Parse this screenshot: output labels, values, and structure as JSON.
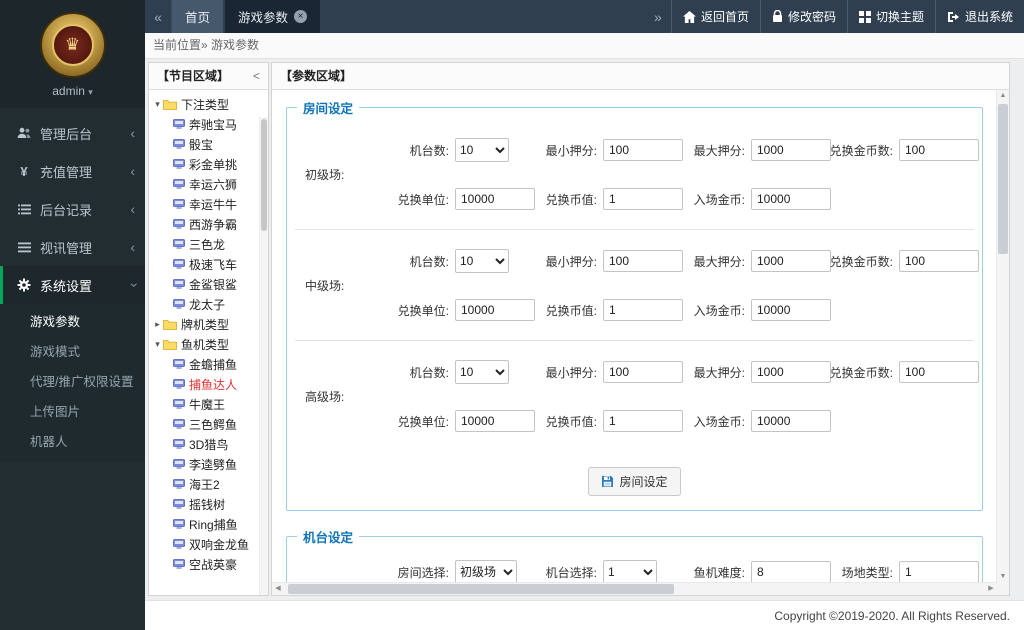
{
  "colors": {
    "accent_green": "#00a65a",
    "legend_blue": "#0d74b8",
    "selected_red": "#e53030",
    "sidebar_bg": "#222d32"
  },
  "sidebar": {
    "username": "admin",
    "menu": [
      {
        "label": "管理后台",
        "icon": "users-icon"
      },
      {
        "label": "充值管理",
        "icon": "yen-icon"
      },
      {
        "label": "后台记录",
        "icon": "list-icon"
      },
      {
        "label": "视讯管理",
        "icon": "rows-icon"
      },
      {
        "label": "系统设置",
        "icon": "gears-icon",
        "expanded": true,
        "active": true
      }
    ],
    "submenu": [
      {
        "label": "游戏参数",
        "active": true
      },
      {
        "label": "游戏模式"
      },
      {
        "label": "代理/推广权限设置"
      },
      {
        "label": "上传图片"
      },
      {
        "label": "机器人"
      }
    ]
  },
  "topbar": {
    "tabs": [
      {
        "label": "首页"
      },
      {
        "label": "游戏参数",
        "active": true,
        "closable": true
      }
    ],
    "actions": [
      {
        "label": "返回首页",
        "icon": "home-icon"
      },
      {
        "label": "修改密码",
        "icon": "lock-icon"
      },
      {
        "label": "切换主题",
        "icon": "theme-icon"
      },
      {
        "label": "退出系统",
        "icon": "logout-icon"
      }
    ]
  },
  "breadcrumb": {
    "prefix": "当前位置",
    "separator": "»",
    "current": "游戏参数"
  },
  "tree": {
    "title": "【节目区域】",
    "nodes": [
      {
        "type": "group",
        "label": "下注类型",
        "expanded": true
      },
      {
        "type": "item",
        "label": "奔驰宝马"
      },
      {
        "type": "item",
        "label": "骰宝"
      },
      {
        "type": "item",
        "label": "彩金单挑"
      },
      {
        "type": "item",
        "label": "幸运六狮"
      },
      {
        "type": "item",
        "label": "幸运牛牛"
      },
      {
        "type": "item",
        "label": "西游争霸"
      },
      {
        "type": "item",
        "label": "三色龙"
      },
      {
        "type": "item",
        "label": "极速飞车"
      },
      {
        "type": "item",
        "label": "金鲨银鲨"
      },
      {
        "type": "item",
        "label": "龙太子"
      },
      {
        "type": "group",
        "label": "牌机类型",
        "expanded": false
      },
      {
        "type": "group",
        "label": "鱼机类型",
        "expanded": true
      },
      {
        "type": "item",
        "label": "金蟾捕鱼"
      },
      {
        "type": "item",
        "label": "捕鱼达人",
        "selected": true
      },
      {
        "type": "item",
        "label": "牛魔王"
      },
      {
        "type": "item",
        "label": "三色鳄鱼"
      },
      {
        "type": "item",
        "label": "3D猎鸟"
      },
      {
        "type": "item",
        "label": "李逵劈鱼"
      },
      {
        "type": "item",
        "label": "海王2"
      },
      {
        "type": "item",
        "label": "摇钱树"
      },
      {
        "type": "item",
        "label": "Ring捕鱼"
      },
      {
        "type": "item",
        "label": "双响金龙鱼"
      },
      {
        "type": "item",
        "label": "空战英豪"
      }
    ]
  },
  "params": {
    "title": "【参数区域】",
    "room_section": {
      "legend": "房间设定",
      "labels": {
        "machine_count": "机台数:",
        "min_bet": "最小押分:",
        "max_bet": "最大押分:",
        "exchange_coins": "兑换金币数:",
        "exchange_unit": "兑换单位:",
        "exchange_value": "兑换币值:",
        "entry_coins": "入场金币:"
      },
      "rooms": [
        {
          "name": "初级场:",
          "machine_count": "10",
          "min_bet": "100",
          "max_bet": "1000",
          "exchange_coins": "100",
          "exchange_unit": "10000",
          "exchange_value": "1",
          "entry_coins": "10000"
        },
        {
          "name": "中级场:",
          "machine_count": "10",
          "min_bet": "100",
          "max_bet": "1000",
          "exchange_coins": "100",
          "exchange_unit": "10000",
          "exchange_value": "1",
          "entry_coins": "10000"
        },
        {
          "name": "高级场:",
          "machine_count": "10",
          "min_bet": "100",
          "max_bet": "1000",
          "exchange_coins": "100",
          "exchange_unit": "10000",
          "exchange_value": "1",
          "entry_coins": "10000"
        }
      ],
      "save_button": "房间设定"
    },
    "machine_section": {
      "legend": "机台设定",
      "labels": {
        "room": "房间选择:",
        "machine": "机台选择:",
        "difficulty": "鱼机难度:",
        "venue": "场地类型:"
      },
      "values": {
        "room": "初级场",
        "machine": "1",
        "difficulty": "8",
        "venue": "1"
      }
    }
  },
  "footer": {
    "copyright": "Copyright ©2019-2020. All Rights Reserved."
  }
}
